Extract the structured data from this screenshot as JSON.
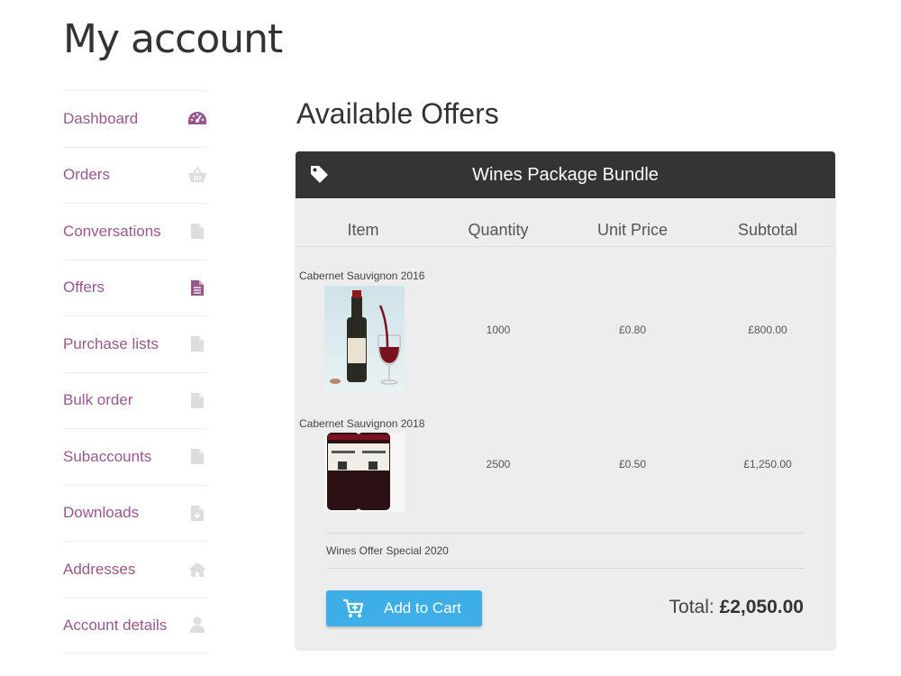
{
  "page": {
    "title": "My account"
  },
  "sidebar": {
    "items": [
      {
        "label": "Dashboard",
        "icon": "dashboard-icon"
      },
      {
        "label": "Orders",
        "icon": "basket-icon"
      },
      {
        "label": "Conversations",
        "icon": "document-icon"
      },
      {
        "label": "Offers",
        "icon": "document-icon"
      },
      {
        "label": "Purchase lists",
        "icon": "document-icon"
      },
      {
        "label": "Bulk order",
        "icon": "document-icon"
      },
      {
        "label": "Subaccounts",
        "icon": "document-icon"
      },
      {
        "label": "Downloads",
        "icon": "download-document-icon"
      },
      {
        "label": "Addresses",
        "icon": "home-icon"
      },
      {
        "label": "Account details",
        "icon": "user-icon"
      }
    ]
  },
  "main": {
    "title": "Available Offers",
    "offer": {
      "name": "Wines Package Bundle",
      "columns": [
        "Item",
        "Quantity",
        "Unit Price",
        "Subtotal"
      ],
      "rows": [
        {
          "name": "Cabernet Sauvignon 2016",
          "quantity": "1000",
          "unit_price": "£0.80",
          "subtotal": "£800.00"
        },
        {
          "name": "Cabernet Sauvignon 2018",
          "quantity": "2500",
          "unit_price": "£0.50",
          "subtotal": "£1,250.00"
        }
      ],
      "note": "Wines Offer Special 2020",
      "add_to_cart_label": "Add to Cart",
      "total_label": "Total:",
      "total_value": "£2,050.00"
    }
  },
  "colors": {
    "accent": "#96588a",
    "header_bg": "#343434",
    "button": "#3eaee8",
    "card_bg": "#ededed"
  }
}
